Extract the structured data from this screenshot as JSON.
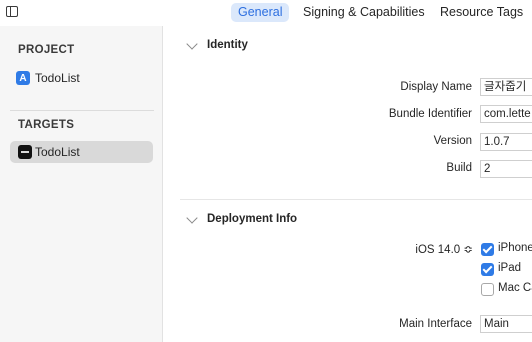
{
  "tabs": [
    {
      "label": "General",
      "active": true
    },
    {
      "label": "Signing & Capabilities",
      "active": false
    },
    {
      "label": "Resource Tags",
      "active": false
    }
  ],
  "sidebar": {
    "project_header": "PROJECT",
    "project_item": "TodoList",
    "targets_header": "TARGETS",
    "target_item": "TodoList"
  },
  "identity": {
    "title": "Identity",
    "display_name_label": "Display Name",
    "display_name_value": "글자줍기",
    "bundle_id_label": "Bundle Identifier",
    "bundle_id_value": "com.lette",
    "version_label": "Version",
    "version_value": "1.0.7",
    "build_label": "Build",
    "build_value": "2"
  },
  "deployment": {
    "title": "Deployment Info",
    "ios_version": "iOS 14.0 ≎",
    "devices": [
      {
        "label": "iPhone",
        "checked": true
      },
      {
        "label": "iPad",
        "checked": true
      },
      {
        "label": "Mac Ca",
        "checked": false
      }
    ],
    "main_interface_label": "Main Interface",
    "main_interface_value": "Main"
  },
  "colors": {
    "accent": "#2f7be6",
    "active_tab_bg": "#dbe8fb",
    "sidebar_bg": "#f6f6f6",
    "selected_item_bg": "#d9d9d9"
  }
}
